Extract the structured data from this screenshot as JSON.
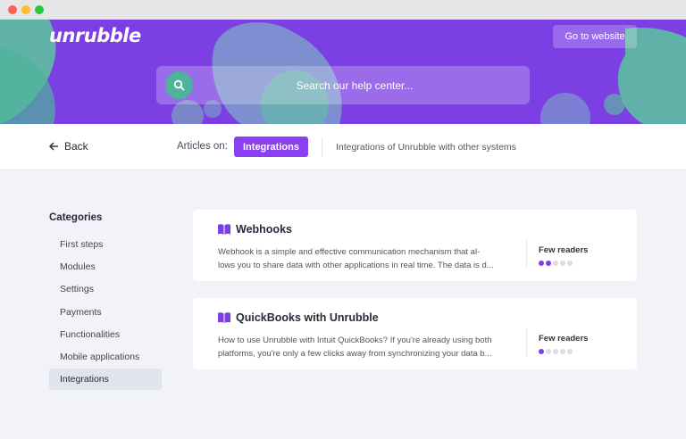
{
  "window": {
    "controls": [
      "close",
      "minimize",
      "maximize"
    ]
  },
  "header": {
    "logo": "unrubble",
    "go_to_website_label": "Go to website",
    "search": {
      "placeholder": "Search our help center..."
    },
    "colors": {
      "brand_purple": "#7b3fe4",
      "blob_green": "#5cc79e"
    }
  },
  "subheader": {
    "back_label": "Back",
    "articles_on_label": "Articles on:",
    "tag_label": "Integrations",
    "tag_description": "Integrations of Unrubble with other systems"
  },
  "sidebar": {
    "title": "Categories",
    "items": [
      {
        "label": "First steps",
        "active": false
      },
      {
        "label": "Modules",
        "active": false
      },
      {
        "label": "Settings",
        "active": false
      },
      {
        "label": "Payments",
        "active": false
      },
      {
        "label": "Functionalities",
        "active": false
      },
      {
        "label": "Mobile applications",
        "active": false
      },
      {
        "label": "Integrations",
        "active": true
      }
    ]
  },
  "articles": [
    {
      "title": "Webhooks",
      "excerpt_line1": "Webhook is a simple and effective communication mechanism that al-",
      "excerpt_line2": "lows you to share data with other applications in real time. The data is d...",
      "readers_label": "Few readers",
      "readers_level": 2,
      "readers_max": 5
    },
    {
      "title": "QuickBooks with Unrubble",
      "excerpt_line1": "How to use Unrubble with Intuit QuickBooks? If you're already using both",
      "excerpt_line2": "platforms, you're only a few clicks away from synchronizing your data b...",
      "readers_label": "Few readers",
      "readers_level": 1,
      "readers_max": 5
    }
  ]
}
